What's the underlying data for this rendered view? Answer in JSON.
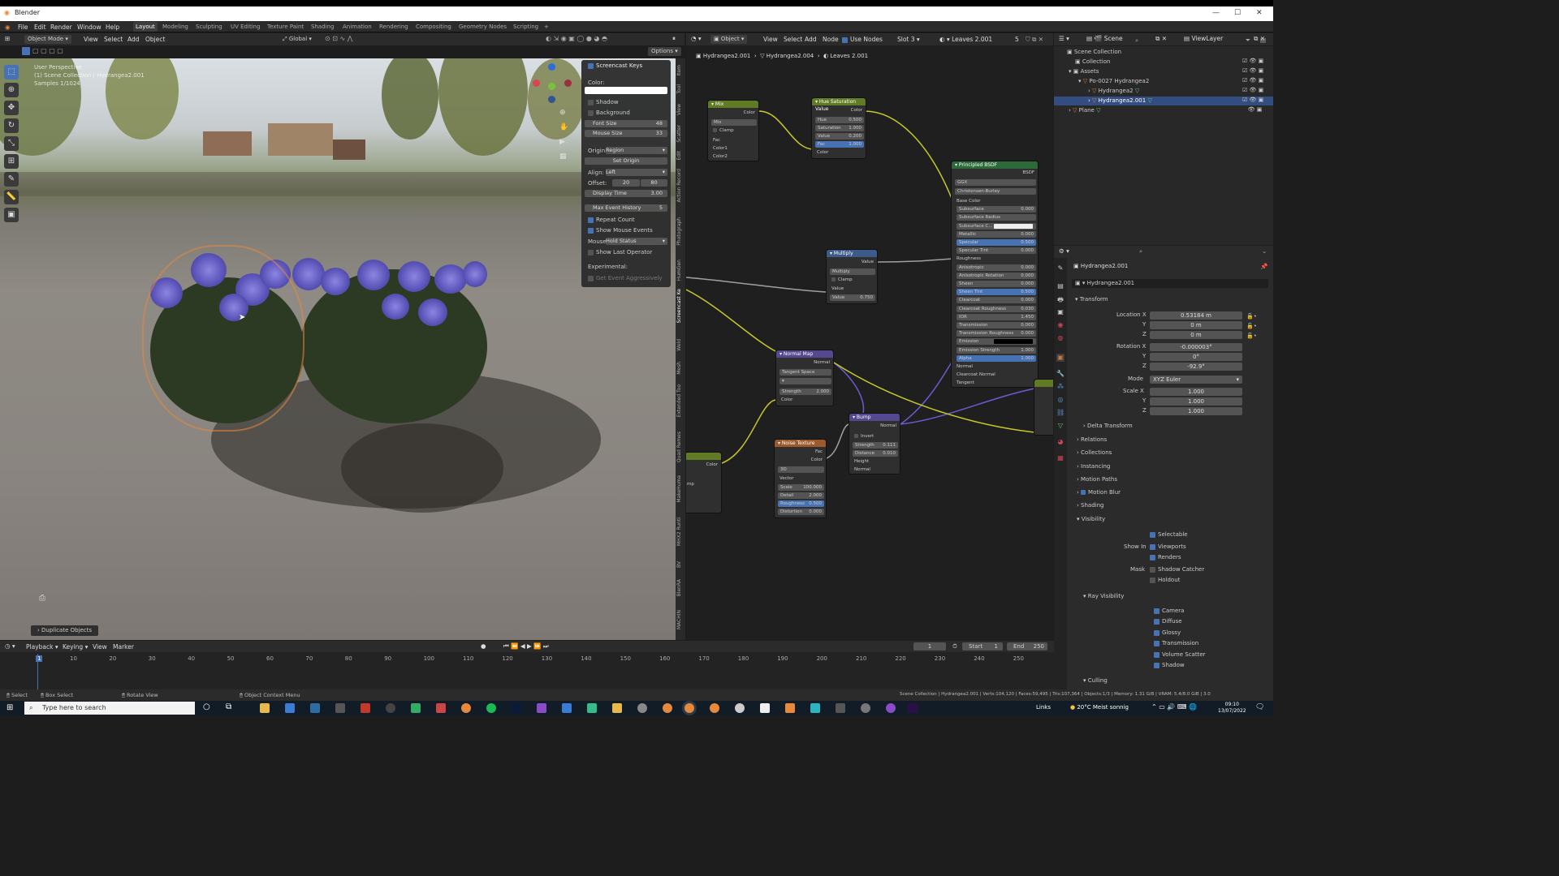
{
  "window": {
    "title": "Blender",
    "controls": [
      "—",
      "☐",
      "✕"
    ]
  },
  "menubar": {
    "menus": [
      "File",
      "Edit",
      "Render",
      "Window",
      "Help"
    ],
    "workspaces": [
      "Layout",
      "Modeling",
      "Sculpting",
      "UV Editing",
      "Texture Paint",
      "Shading",
      "Animation",
      "Rendering",
      "Compositing",
      "Geometry Nodes",
      "Scripting",
      "+"
    ],
    "active_workspace": "Layout"
  },
  "viewport_header": {
    "mode": "Object Mode",
    "menus": [
      "View",
      "Select",
      "Add",
      "Object"
    ],
    "orientation": "Global",
    "options": "Options"
  },
  "viewport": {
    "overlay_lines": [
      "User Perspective",
      "(1) Scene Collection | Hydrangea2.001",
      "Samples 1/1024"
    ],
    "last_op": "Duplicate Objects"
  },
  "screencast_panel": {
    "title": "Screencast Keys",
    "color_label": "Color:",
    "shadow": "Shadow",
    "background": "Background",
    "font_size_label": "Font Size",
    "font_size": "48",
    "mouse_size_label": "Mouse Size",
    "mouse_size": "33",
    "origin_label": "Origin:",
    "origin": "Region",
    "set_origin": "Set Origin",
    "align_label": "Align:",
    "align": "Left",
    "offset_label": "Offset:",
    "offset_x": "20",
    "offset_y": "80",
    "display_time_label": "Display Time",
    "display_time": "3.00",
    "max_event_label": "Max Event History",
    "max_event": "5",
    "repeat_count": "Repeat Count",
    "show_mouse_events": "Show Mouse Events",
    "mouse_label": "Mouse:",
    "mouse_mode": "Hold Status",
    "show_last_op": "Show Last Operator",
    "experimental": "Experimental:",
    "get_event": "Get Event Aggressively"
  },
  "side_tabs": [
    "Item",
    "Tool",
    "View",
    "Scatter",
    "Edit",
    "Action Record",
    "Photograph",
    "HumGen",
    "Screencast Ke",
    "Weld",
    "Mesh",
    "Extended Too",
    "Quad Remes",
    "MakeHuma",
    "MHX2 Runti",
    "BV",
    "BlenRA",
    "MACHIN"
  ],
  "node_header": {
    "object": "Object",
    "menus": [
      "View",
      "Select",
      "Add",
      "Node"
    ],
    "use_nodes": "Use Nodes",
    "slot": "Slot 3",
    "material": "Leaves 2.001",
    "users": "5"
  },
  "node_breadcrumb": [
    "Hydrangea2.001",
    "Hydrangea2.004",
    "Leaves 2.001"
  ],
  "nodes": {
    "mix": {
      "title": "Mix",
      "out": "Color",
      "blend": "Mix",
      "clamp": "Clamp",
      "fac": "Fac",
      "c1": "Color1",
      "c2": "Color2"
    },
    "hsv": {
      "title": "Hue Saturation Value",
      "out": "Color",
      "rows": [
        "Hue",
        "Saturation",
        "Value",
        "Fac"
      ],
      "values": [
        "0.500",
        "1.000",
        "0.200",
        "1.000"
      ],
      "in": "Color"
    },
    "bsdf": {
      "title": "Principled BSDF",
      "out": "BSDF",
      "dist": "GGX",
      "sss": "Christensen-Burley",
      "rows": [
        "Base Color",
        "Subsurface",
        "Subsurface Radius",
        "Subsurface C...",
        "Metallic",
        "Specular",
        "Specular Tint",
        "Roughness",
        "Anisotropic",
        "Anisotropic Rotation",
        "Sheen",
        "Sheen Tint",
        "Clearcoat",
        "Clearcoat Roughness",
        "IOR",
        "Transmission",
        "Transmission Roughness",
        "Emission",
        "Emission Strength",
        "Alpha",
        "Normal",
        "Clearcoat Normal",
        "Tangent"
      ],
      "values": [
        "",
        "0.000",
        "",
        "",
        "0.000",
        "0.500",
        "0.000",
        "",
        "0.000",
        "0.000",
        "0.000",
        "0.500",
        "0.000",
        "0.030",
        "1.450",
        "0.000",
        "0.000",
        "",
        "1.000",
        "1.000",
        "",
        "",
        ""
      ]
    },
    "multiply": {
      "title": "Multiply",
      "out": "Value",
      "op": "Multiply",
      "clamp": "Clamp",
      "in": "Value",
      "value_label": "Value",
      "value": "0.750"
    },
    "normalmap": {
      "title": "Normal Map",
      "out": "Normal",
      "space": "Tangent Space",
      "strength_label": "Strength",
      "strength": "2.000",
      "in": "Color"
    },
    "bump": {
      "title": "Bump",
      "out": "Normal",
      "invert": "Invert",
      "strength_label": "Strength",
      "strength": "0.111",
      "distance_label": "Distance",
      "distance": "0.010",
      "height": "Height",
      "normal": "Normal"
    },
    "noise": {
      "title": "Noise Texture",
      "fac": "Fac",
      "color": "Color",
      "dim": "3D",
      "vector": "Vector",
      "rows": [
        "Scale",
        "Detail",
        "Roughness",
        "Distortion"
      ],
      "values": [
        "100.000",
        "2.000",
        "0.500",
        "0.000"
      ]
    },
    "partial_left": {
      "out": "Color",
      "label": "mp"
    }
  },
  "outliner": {
    "header": "Scene",
    "view_layer": "ViewLayer",
    "items": [
      "Scene Collection",
      "Collection",
      "Assets",
      "Po-0027 Hydrangea2",
      "Hydrangea2",
      "Hydrangea2.001",
      "Plane"
    ]
  },
  "properties": {
    "object_name": "Hydrangea2.001",
    "data_name": "Hydrangea2.001",
    "transform": "Transform",
    "location_x_label": "Location X",
    "location": [
      "0.53184 m",
      "0 m",
      "0 m"
    ],
    "rotation_x_label": "Rotation X",
    "rotation": [
      "-0.000003°",
      "0°",
      "-92.9°"
    ],
    "mode_label": "Mode",
    "mode": "XYZ Euler",
    "scale_x_label": "Scale X",
    "scale": [
      "1.000",
      "1.000",
      "1.000"
    ],
    "axis_y": "Y",
    "axis_z": "Z",
    "sections": [
      "Delta Transform",
      "Relations",
      "Collections",
      "Instancing",
      "Motion Paths",
      "Motion Blur",
      "Shading",
      "Visibility"
    ],
    "selectable": "Selectable",
    "show_in": "Show In",
    "viewports": "Viewports",
    "renders": "Renders",
    "mask": "Mask",
    "shadow_catcher": "Shadow Catcher",
    "holdout": "Holdout",
    "ray_visibility": "Ray Visibility",
    "rays": [
      "Camera",
      "Diffuse",
      "Glossy",
      "Transmission",
      "Volume Scatter",
      "Shadow"
    ],
    "culling": "Culling"
  },
  "timeline": {
    "menus": [
      "Playback",
      "Keying",
      "View",
      "Marker"
    ],
    "current": "1",
    "start_label": "Start",
    "start": "1",
    "end_label": "End",
    "end": "250",
    "frames": [
      "1",
      "10",
      "20",
      "30",
      "40",
      "50",
      "60",
      "70",
      "80",
      "90",
      "100",
      "110",
      "120",
      "130",
      "140",
      "150",
      "160",
      "170",
      "180",
      "190",
      "200",
      "210",
      "220",
      "230",
      "240",
      "250"
    ]
  },
  "statusbar": {
    "left": [
      "Select",
      "Box Select",
      "Rotate View",
      "Object Context Menu"
    ],
    "right": "Scene Collection | Hydrangea2.001 | Verts:104,120 | Faces:59,495 | Tris:107,364 | Objects:1/3 | Memory: 1.31 GiB | VRAM: 5.4/8.0 GiB | 3.0"
  },
  "taskbar": {
    "search": "Type here to search",
    "links": "Links",
    "weather": "20°C  Meist sonnig",
    "time": "09:10",
    "date": "13/07/2022"
  },
  "colors": {
    "accent": "#4772b3",
    "orange": "#e8883a",
    "node_green": "#617a24",
    "node_blue": "#3c5a8a",
    "node_purple": "#55488e",
    "node_orange": "#9b5a2c",
    "bsdf_header": "#2c6a3a"
  }
}
